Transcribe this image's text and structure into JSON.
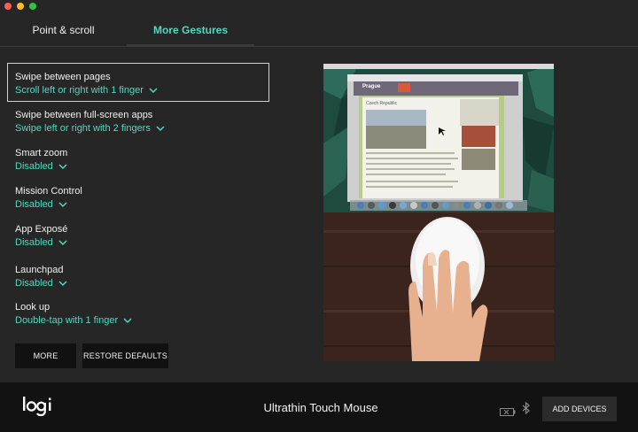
{
  "tabs": [
    {
      "label": "Point & scroll"
    },
    {
      "label": "More Gestures"
    }
  ],
  "gestures": [
    {
      "title": "Swipe between pages",
      "value": "Scroll left or right with 1 finger"
    },
    {
      "title": "Swipe between full-screen apps",
      "value": "Swipe left or right with 2 fingers"
    },
    {
      "title": "Smart zoom",
      "value": "Disabled"
    },
    {
      "title": "Mission Control",
      "value": "Disabled"
    },
    {
      "title": "App Exposé",
      "value": "Disabled"
    },
    {
      "title": "Launchpad",
      "value": "Disabled"
    },
    {
      "title": "Look up",
      "value": "Double-tap with 1 finger"
    }
  ],
  "buttons": {
    "more": "MORE",
    "restore": "RESTORE DEFAULTS",
    "add_devices": "ADD DEVICES"
  },
  "preview": {
    "page_header": "Prague",
    "page_heading": "Czech Republic"
  },
  "footer": {
    "logo": "logi",
    "device": "Ultrathin Touch Mouse"
  },
  "colors": {
    "accent": "#53d8c0",
    "background": "#262626",
    "footer": "#121212"
  }
}
